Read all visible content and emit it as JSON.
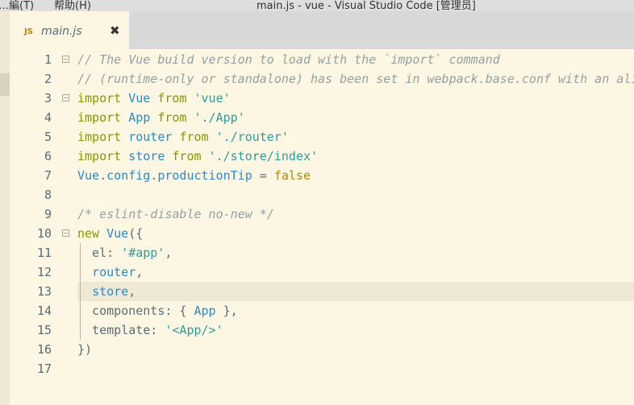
{
  "window": {
    "menu_left": "…編(T)",
    "menu_help": "帮助(H)",
    "title": "main.js - vue - Visual Studio Code [管理员]"
  },
  "tab": {
    "icon": "JS",
    "filename": "main.js",
    "close": "✖"
  },
  "editor": {
    "current_line": 13,
    "lines": [
      {
        "n": "1",
        "fold": true,
        "tokens": [
          {
            "t": "// The Vue build version to load with the `import` command",
            "c": "c"
          }
        ]
      },
      {
        "n": "2",
        "fold": false,
        "tokens": [
          {
            "t": "// (runtime-only or standalone) has been set in webpack.base.conf with an alias.",
            "c": "c"
          }
        ]
      },
      {
        "n": "3",
        "fold": true,
        "tokens": [
          {
            "t": "import",
            "c": "k"
          },
          {
            "t": " ",
            "c": "p"
          },
          {
            "t": "Vue",
            "c": "v"
          },
          {
            "t": " ",
            "c": "p"
          },
          {
            "t": "from",
            "c": "k"
          },
          {
            "t": " ",
            "c": "p"
          },
          {
            "t": "'vue'",
            "c": "s"
          }
        ]
      },
      {
        "n": "4",
        "fold": false,
        "tokens": [
          {
            "t": "import",
            "c": "k"
          },
          {
            "t": " ",
            "c": "p"
          },
          {
            "t": "App",
            "c": "v"
          },
          {
            "t": " ",
            "c": "p"
          },
          {
            "t": "from",
            "c": "k"
          },
          {
            "t": " ",
            "c": "p"
          },
          {
            "t": "'./App'",
            "c": "s"
          }
        ]
      },
      {
        "n": "5",
        "fold": false,
        "tokens": [
          {
            "t": "import",
            "c": "k"
          },
          {
            "t": " ",
            "c": "p"
          },
          {
            "t": "router",
            "c": "v"
          },
          {
            "t": " ",
            "c": "p"
          },
          {
            "t": "from",
            "c": "k"
          },
          {
            "t": " ",
            "c": "p"
          },
          {
            "t": "'./router'",
            "c": "s"
          }
        ]
      },
      {
        "n": "6",
        "fold": false,
        "tokens": [
          {
            "t": "import",
            "c": "k"
          },
          {
            "t": " ",
            "c": "p"
          },
          {
            "t": "store",
            "c": "v"
          },
          {
            "t": " ",
            "c": "p"
          },
          {
            "t": "from",
            "c": "k"
          },
          {
            "t": " ",
            "c": "p"
          },
          {
            "t": "'./store/index'",
            "c": "s"
          }
        ]
      },
      {
        "n": "7",
        "fold": false,
        "tokens": [
          {
            "t": "Vue",
            "c": "v"
          },
          {
            "t": ".",
            "c": "p"
          },
          {
            "t": "config",
            "c": "v"
          },
          {
            "t": ".",
            "c": "p"
          },
          {
            "t": "productionTip",
            "c": "v"
          },
          {
            "t": " = ",
            "c": "p"
          },
          {
            "t": "false",
            "c": "b"
          }
        ]
      },
      {
        "n": "8",
        "fold": false,
        "tokens": []
      },
      {
        "n": "9",
        "fold": false,
        "tokens": [
          {
            "t": "/* eslint-disable no-new */",
            "c": "c"
          }
        ]
      },
      {
        "n": "10",
        "fold": true,
        "tokens": [
          {
            "t": "new",
            "c": "k"
          },
          {
            "t": " ",
            "c": "p"
          },
          {
            "t": "Vue",
            "c": "v"
          },
          {
            "t": "({",
            "c": "p"
          }
        ]
      },
      {
        "n": "11",
        "fold": false,
        "tokens": [
          {
            "t": "  el: ",
            "c": "p"
          },
          {
            "t": "'#app'",
            "c": "s"
          },
          {
            "t": ",",
            "c": "p"
          }
        ]
      },
      {
        "n": "12",
        "fold": false,
        "tokens": [
          {
            "t": "  ",
            "c": "p"
          },
          {
            "t": "router",
            "c": "v"
          },
          {
            "t": ",",
            "c": "p"
          }
        ]
      },
      {
        "n": "13",
        "fold": false,
        "tokens": [
          {
            "t": "  ",
            "c": "p"
          },
          {
            "t": "store",
            "c": "v"
          },
          {
            "t": ",",
            "c": "p"
          }
        ]
      },
      {
        "n": "14",
        "fold": false,
        "tokens": [
          {
            "t": "  components: { ",
            "c": "p"
          },
          {
            "t": "App",
            "c": "v"
          },
          {
            "t": " },",
            "c": "p"
          }
        ]
      },
      {
        "n": "15",
        "fold": false,
        "tokens": [
          {
            "t": "  template: ",
            "c": "p"
          },
          {
            "t": "'<App/>'",
            "c": "s"
          }
        ]
      },
      {
        "n": "16",
        "fold": false,
        "tokens": [
          {
            "t": "})",
            "c": "p"
          }
        ]
      },
      {
        "n": "17",
        "fold": false,
        "tokens": []
      }
    ]
  },
  "colors": {
    "background": "#fdf6e3",
    "comment": "#93a1a1",
    "keyword": "#859900",
    "variable": "#268bd2",
    "string": "#2aa198",
    "boolean": "#b58900",
    "line_number": "#586e75"
  }
}
